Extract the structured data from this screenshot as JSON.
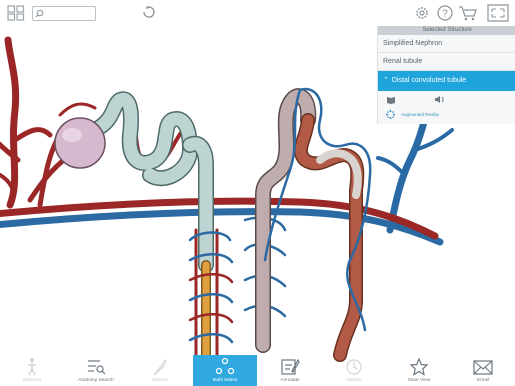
{
  "panel": {
    "header": "Selected Structure",
    "items": [
      "Simplified Nephron",
      "Renal tubule",
      "Distal convoluted tubule"
    ],
    "ar_label": "Augmented Reality"
  },
  "search": {
    "placeholder": ""
  },
  "bottom": {
    "items": [
      {
        "label": "Systems",
        "icon": "figure-icon"
      },
      {
        "label": "Anatomy Search",
        "icon": "list-search-icon"
      },
      {
        "label": "Dissect",
        "icon": "scalpel-icon"
      },
      {
        "label": "Multi Select",
        "icon": "multi-select-icon"
      },
      {
        "label": "Annotate",
        "icon": "annotate-icon"
      },
      {
        "label": "History",
        "icon": "history-icon"
      },
      {
        "label": "Save View",
        "icon": "star-icon"
      },
      {
        "label": "Email",
        "icon": "email-icon"
      }
    ]
  },
  "colors": {
    "accent": "#1fa4dc",
    "artery": "#a02a2a",
    "vein": "#2e6fa8",
    "tubule": "#b9d0ce"
  }
}
